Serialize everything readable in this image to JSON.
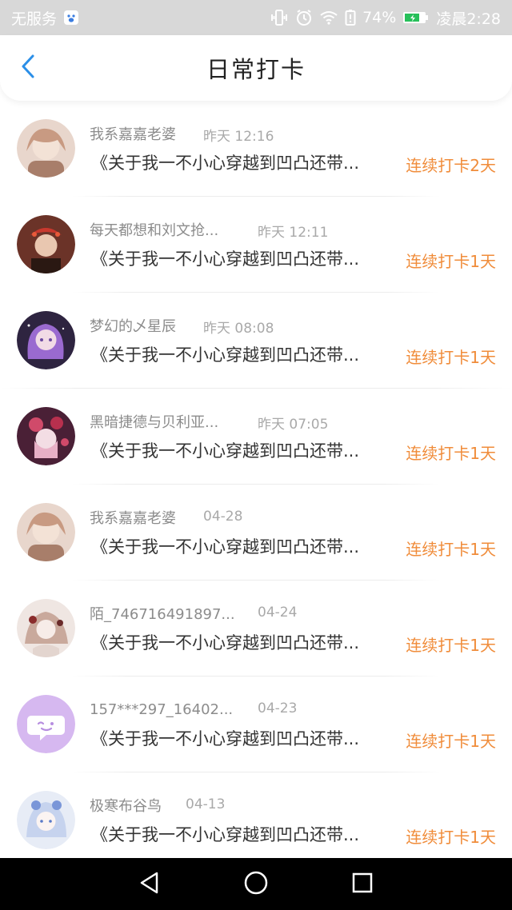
{
  "status_bar": {
    "carrier": "无服务",
    "battery_percent": "74%",
    "time": "凌晨2:28"
  },
  "header": {
    "title": "日常打卡"
  },
  "items": [
    {
      "name": "我系嘉嘉老婆",
      "time": "昨天 12:16",
      "content": "《关于我一不小心穿越到凹凸还带...",
      "streak": "连续打卡2天",
      "avatar_color": "#c89a82"
    },
    {
      "name": "每天都想和刘文抢...",
      "time": "昨天 12:11",
      "content": "《关于我一不小心穿越到凹凸还带...",
      "streak": "连续打卡1天",
      "avatar_color": "#6b3328"
    },
    {
      "name": "梦幻的乄星辰",
      "time": "昨天 08:08",
      "content": "《关于我一不小心穿越到凹凸还带...",
      "streak": "连续打卡1天",
      "avatar_color": "#7b5aa8"
    },
    {
      "name": "黑暗捷德与贝利亚...",
      "time": "昨天 07:05",
      "content": "《关于我一不小心穿越到凹凸还带...",
      "streak": "连续打卡1天",
      "avatar_color": "#b0405a"
    },
    {
      "name": "我系嘉嘉老婆",
      "time": "04-28",
      "content": "《关于我一不小心穿越到凹凸还带...",
      "streak": "连续打卡1天",
      "avatar_color": "#c89a82"
    },
    {
      "name": "陌_746716491897...",
      "time": "04-24",
      "content": "《关于我一不小心穿越到凹凸还带...",
      "streak": "连续打卡1天",
      "avatar_color": "#d9c8c0"
    },
    {
      "name": "157***297_16402...",
      "time": "04-23",
      "content": "《关于我一不小心穿越到凹凸还带...",
      "streak": "连续打卡1天",
      "avatar_color": "#d6b8f0"
    },
    {
      "name": "极寒布谷鸟",
      "time": "04-13",
      "content": "《关于我一不小心穿越到凹凸还带...",
      "streak": "连续打卡1天",
      "avatar_color": "#c6d3ee"
    }
  ],
  "icons": {
    "back": "chevron-left-icon",
    "nav_back": "triangle-back-icon",
    "nav_home": "circle-home-icon",
    "nav_recent": "square-recent-icon"
  },
  "colors": {
    "streak": "#f08c3a",
    "back_arrow": "#2b8fe8",
    "status_bar": "#d8d8d8"
  }
}
